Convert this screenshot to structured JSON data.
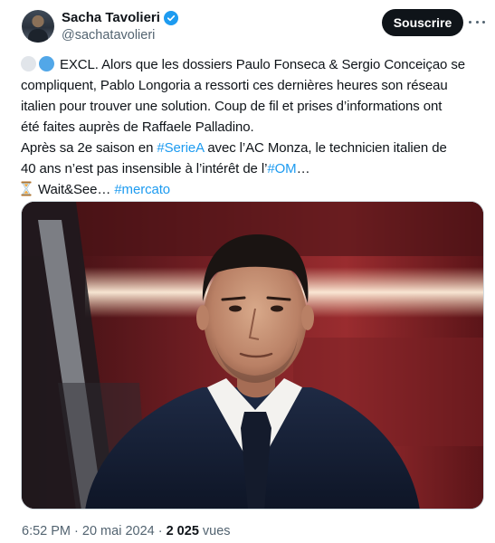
{
  "author": {
    "display_name": "Sacha Tavolieri",
    "handle": "@sachatavolieri",
    "verified_icon": "verified-badge-icon"
  },
  "actions": {
    "follow_label": "Souscrire",
    "more_icon": "more-horizontal-icon"
  },
  "tweet": {
    "line1": "EXCL. Alors que les dossiers Paulo Fonseca & Sergio Conceiçao se",
    "line2": "compliquent, Pablo Longoria a ressorti ces dernières heures son réseau",
    "line3": "italien pour trouver une solution. Coup de fil et prises d’informations ont",
    "line4": "été faites auprès de Raffaele Palladino.",
    "line5_pre": "Après sa 2e saison en ",
    "line5_tag": "#SerieA",
    "line5_post": " avec l’AC Monza, le technicien italien de",
    "line6_pre": "40 ans n’est pas insensible à l’intérêt de l’",
    "line6_tag": "#OM",
    "line6_post": "…",
    "line7_pre": "Wait&See… ",
    "line7_tag": "#mercato"
  },
  "meta": {
    "time": "6:52 PM",
    "sep1": " · ",
    "date": "20 mai 2024",
    "sep2": " · ",
    "views_count": "2 025",
    "views_label": " vues"
  },
  "colors": {
    "link": "#1d9bf0",
    "text": "#0f1419",
    "muted": "#536471",
    "button": "#0f1419"
  }
}
